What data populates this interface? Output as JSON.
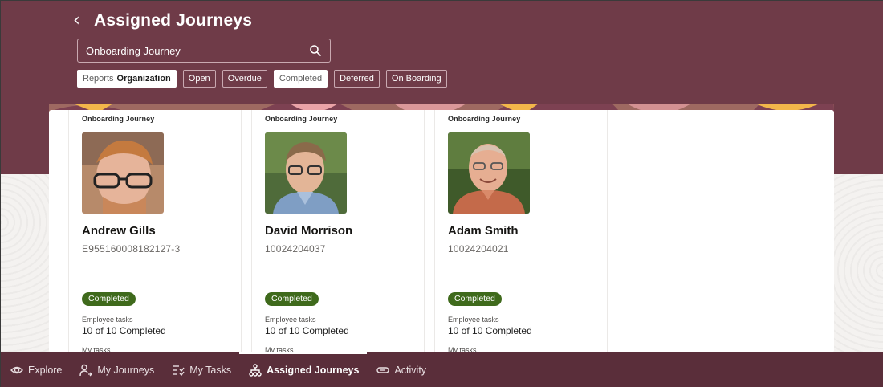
{
  "header": {
    "title": "Assigned Journeys"
  },
  "search": {
    "value": "Onboarding Journey"
  },
  "filters": {
    "reports_prefix": "Reports",
    "reports_value": "Organization",
    "chips": [
      "Open",
      "Overdue",
      "Completed",
      "Deferred",
      "On Boarding"
    ]
  },
  "cards": [
    {
      "journey": "Onboarding Journey",
      "name": "Andrew Gills",
      "id": "E955160008182127-3",
      "status": "Completed",
      "employee_tasks_label": "Employee tasks",
      "employee_tasks_value": "10 of 10 Completed",
      "my_tasks_label": "My tasks"
    },
    {
      "journey": "Onboarding Journey",
      "name": "David Morrison",
      "id": "10024204037",
      "status": "Completed",
      "employee_tasks_label": "Employee tasks",
      "employee_tasks_value": "10 of 10 Completed",
      "my_tasks_label": "My tasks"
    },
    {
      "journey": "Onboarding Journey",
      "name": "Adam Smith",
      "id": "10024204021",
      "status": "Completed",
      "employee_tasks_label": "Employee tasks",
      "employee_tasks_value": "10 of 10 Completed",
      "my_tasks_label": "My tasks"
    }
  ],
  "nav": {
    "items": [
      "Explore",
      "My Journeys",
      "My Tasks",
      "Assigned Journeys",
      "Activity"
    ],
    "active": "Assigned Journeys"
  },
  "colors": {
    "banner": "#6f3b48",
    "nav_bg": "#5a2e3a",
    "badge": "#3f6a1c"
  }
}
